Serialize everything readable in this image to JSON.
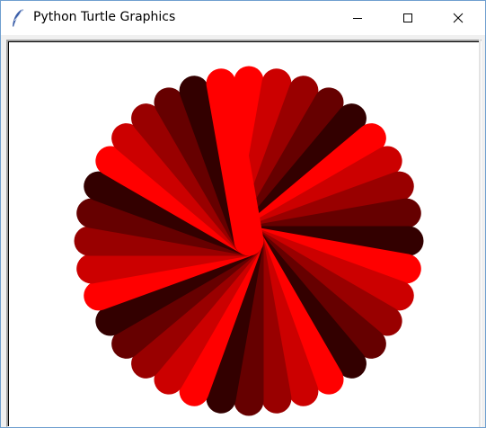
{
  "window": {
    "title": "Python Turtle Graphics",
    "icon": "feather-icon"
  },
  "controls": {
    "minimize_icon": "minimize-icon",
    "maximize_icon": "maximize-icon",
    "close_icon": "close-icon"
  },
  "drawing": {
    "shape": "radial-petals",
    "petal_count": 36,
    "colors": [
      "#ff0000",
      "#cc0000",
      "#990000",
      "#660000",
      "#330000"
    ],
    "background": "#ffffff"
  }
}
